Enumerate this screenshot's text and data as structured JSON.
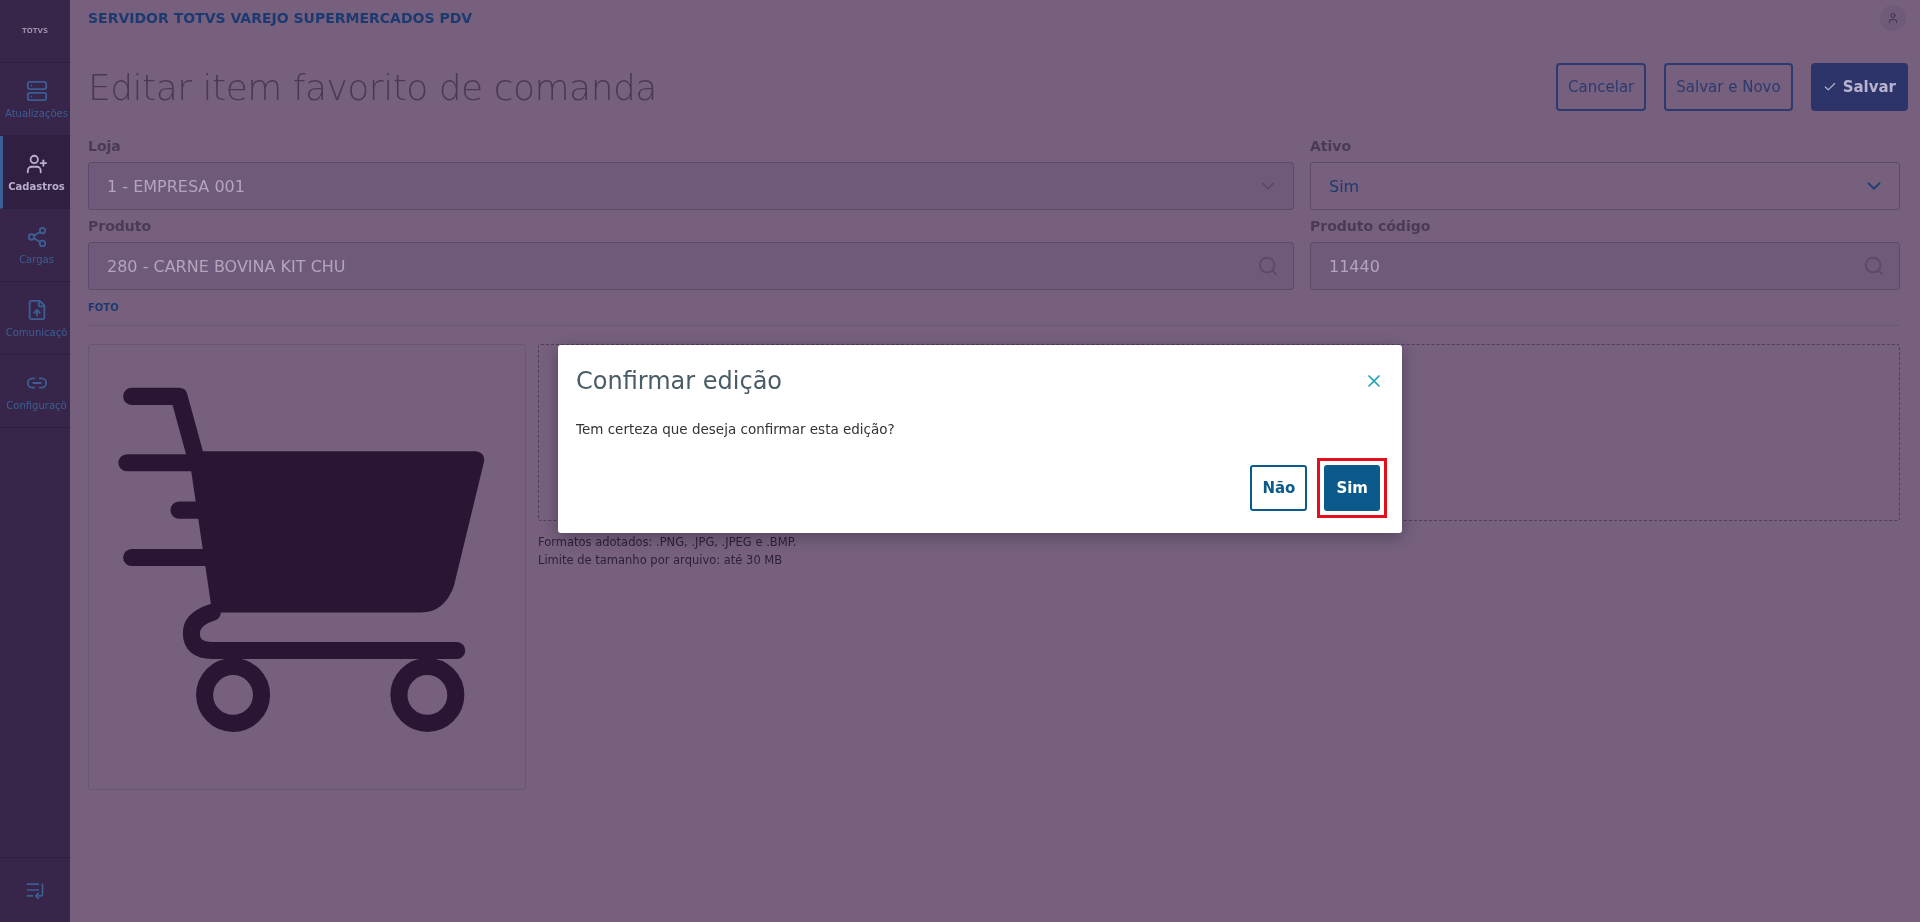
{
  "sidebar": {
    "logo": "TOTVS",
    "items": [
      {
        "label": "Atualizações",
        "selected": false
      },
      {
        "label": "Cadastros",
        "selected": true
      },
      {
        "label": "Cargas",
        "selected": false
      },
      {
        "label": "Comunicaçõ",
        "selected": false
      },
      {
        "label": "Configuraçõ",
        "selected": false
      }
    ]
  },
  "header": {
    "title": "SERVIDOR TOTVS VAREJO SUPERMERCADOS PDV"
  },
  "page": {
    "title": "Editar item favorito de comanda",
    "actions": [
      {
        "label": "Cancelar",
        "kind": "secondary"
      },
      {
        "label": "Salvar e Novo",
        "kind": "secondary"
      },
      {
        "label": "Salvar",
        "kind": "primary"
      }
    ]
  },
  "form": {
    "rows": [
      [
        {
          "label": "Loja",
          "value": "1 - EMPRESA 001",
          "kind": "select",
          "disabled": true
        },
        {
          "label": "Ativo",
          "value": "Sim",
          "kind": "select",
          "disabled": false
        }
      ],
      [
        {
          "label": "Produto",
          "value": "280 - CARNE BOVINA KIT CHU",
          "kind": "search",
          "disabled": true
        },
        {
          "label": "Produto código",
          "value": "11440",
          "kind": "search",
          "disabled": true
        }
      ]
    ]
  },
  "photo": {
    "section": "FOTO",
    "image": {
      "kind": "picture"
    },
    "hints": [
      "Formatos adotados: .PNG, .JPG, .JPEG e .BMP.",
      "Limite de tamanho por arquivo: até 30 MB"
    ]
  },
  "dialog": {
    "title": "Confirmar edição",
    "message": "Tem certeza que deseja confirmar esta edição?",
    "buttons": [
      {
        "label": "Não",
        "kind": "secondary",
        "highlighted": false
      },
      {
        "label": "Sim",
        "kind": "primary",
        "highlighted": true
      }
    ]
  }
}
